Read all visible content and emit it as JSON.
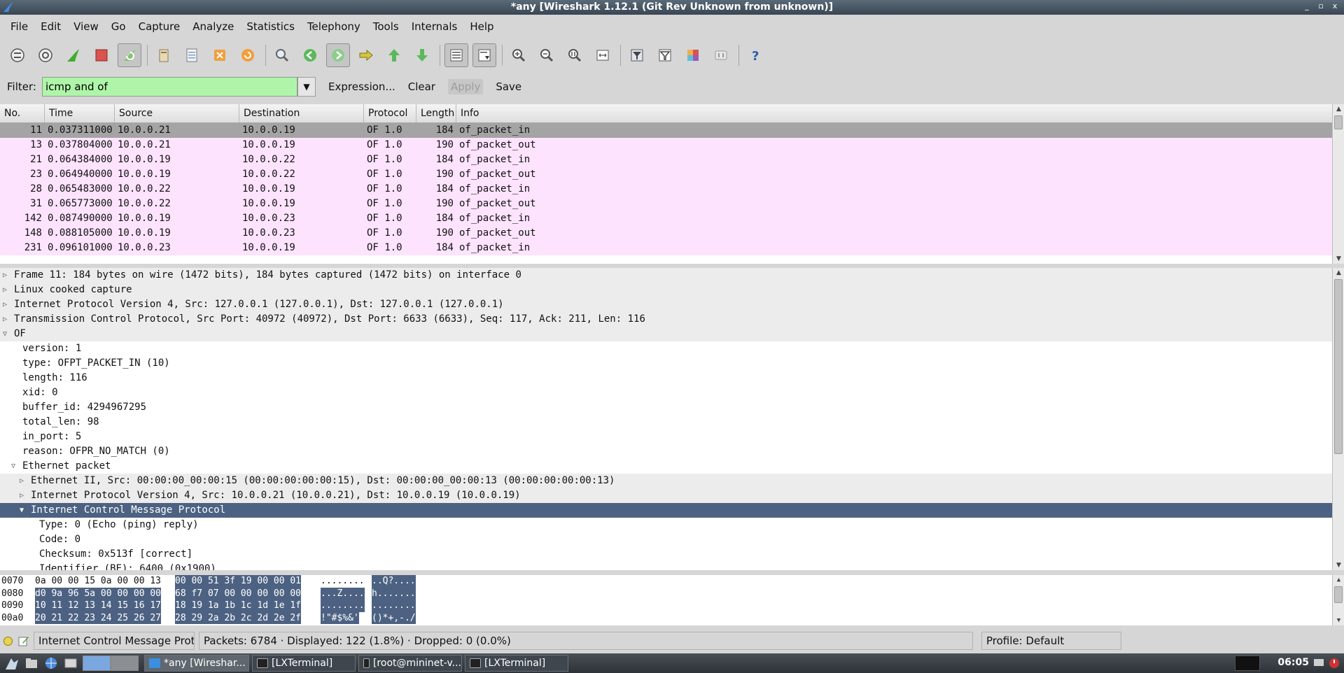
{
  "window": {
    "title": "*any   [Wireshark 1.12.1  (Git Rev Unknown from unknown)]",
    "buttons": [
      "_",
      "▫",
      "x"
    ]
  },
  "menu": [
    "File",
    "Edit",
    "View",
    "Go",
    "Capture",
    "Analyze",
    "Statistics",
    "Telephony",
    "Tools",
    "Internals",
    "Help"
  ],
  "filter": {
    "label": "Filter:",
    "value": "icmp and of",
    "expression_label": "Expression...",
    "clear_label": "Clear",
    "apply_label": "Apply",
    "save_label": "Save"
  },
  "packet_list": {
    "columns": [
      "No.",
      "Time",
      "Source",
      "Destination",
      "Protocol",
      "Length",
      "Info"
    ],
    "rows": [
      {
        "no": "11",
        "time": "0.037311000",
        "src": "10.0.0.21",
        "dst": "10.0.0.19",
        "proto": "OF 1.0",
        "len": "184",
        "info": "of_packet_in"
      },
      {
        "no": "13",
        "time": "0.037804000",
        "src": "10.0.0.21",
        "dst": "10.0.0.19",
        "proto": "OF 1.0",
        "len": "190",
        "info": "of_packet_out"
      },
      {
        "no": "21",
        "time": "0.064384000",
        "src": "10.0.0.19",
        "dst": "10.0.0.22",
        "proto": "OF 1.0",
        "len": "184",
        "info": "of_packet_in"
      },
      {
        "no": "23",
        "time": "0.064940000",
        "src": "10.0.0.19",
        "dst": "10.0.0.22",
        "proto": "OF 1.0",
        "len": "190",
        "info": "of_packet_out"
      },
      {
        "no": "28",
        "time": "0.065483000",
        "src": "10.0.0.22",
        "dst": "10.0.0.19",
        "proto": "OF 1.0",
        "len": "184",
        "info": "of_packet_in"
      },
      {
        "no": "31",
        "time": "0.065773000",
        "src": "10.0.0.22",
        "dst": "10.0.0.19",
        "proto": "OF 1.0",
        "len": "190",
        "info": "of_packet_out"
      },
      {
        "no": "142",
        "time": "0.087490000",
        "src": "10.0.0.19",
        "dst": "10.0.0.23",
        "proto": "OF 1.0",
        "len": "184",
        "info": "of_packet_in"
      },
      {
        "no": "148",
        "time": "0.088105000",
        "src": "10.0.0.19",
        "dst": "10.0.0.23",
        "proto": "OF 1.0",
        "len": "190",
        "info": "of_packet_out"
      },
      {
        "no": "231",
        "time": "0.096101000",
        "src": "10.0.0.23",
        "dst": "10.0.0.19",
        "proto": "OF 1.0",
        "len": "184",
        "info": "of_packet_in"
      }
    ]
  },
  "details": [
    {
      "text": "Frame 11: 184 bytes on wire (1472 bits), 184 bytes captured (1472 bits) on interface 0",
      "level": 0,
      "exp": "closed",
      "style": "shade"
    },
    {
      "text": "Linux cooked capture",
      "level": 0,
      "exp": "closed",
      "style": "shade"
    },
    {
      "text": "Internet Protocol Version 4, Src: 127.0.0.1 (127.0.0.1), Dst: 127.0.0.1 (127.0.0.1)",
      "level": 0,
      "exp": "closed",
      "style": "shade"
    },
    {
      "text": "Transmission Control Protocol, Src Port: 40972 (40972), Dst Port: 6633 (6633), Seq: 117, Ack: 211, Len: 116",
      "level": 0,
      "exp": "closed",
      "style": "shade"
    },
    {
      "text": "OF",
      "level": 0,
      "exp": "open",
      "style": "shade"
    },
    {
      "text": "version: 1",
      "level": 1,
      "exp": "",
      "style": ""
    },
    {
      "text": "type: OFPT_PACKET_IN (10)",
      "level": 1,
      "exp": "",
      "style": ""
    },
    {
      "text": "length: 116",
      "level": 1,
      "exp": "",
      "style": ""
    },
    {
      "text": "xid: 0",
      "level": 1,
      "exp": "",
      "style": ""
    },
    {
      "text": "buffer_id: 4294967295",
      "level": 1,
      "exp": "",
      "style": ""
    },
    {
      "text": "total_len: 98",
      "level": 1,
      "exp": "",
      "style": ""
    },
    {
      "text": "in_port: 5",
      "level": 1,
      "exp": "",
      "style": ""
    },
    {
      "text": "reason: OFPR_NO_MATCH (0)",
      "level": 1,
      "exp": "",
      "style": ""
    },
    {
      "text": "Ethernet packet",
      "level": 1,
      "exp": "open",
      "style": ""
    },
    {
      "text": "Ethernet II, Src: 00:00:00_00:00:15 (00:00:00:00:00:15), Dst: 00:00:00_00:00:13 (00:00:00:00:00:13)",
      "level": 2,
      "exp": "closed",
      "style": "shade"
    },
    {
      "text": "Internet Protocol Version 4, Src: 10.0.0.21 (10.0.0.21), Dst: 10.0.0.19 (10.0.0.19)",
      "level": 2,
      "exp": "closed",
      "style": "shade"
    },
    {
      "text": "Internet Control Message Protocol",
      "level": 2,
      "exp": "open",
      "style": "sel"
    },
    {
      "text": "Type: 0 (Echo (ping) reply)",
      "level": 3,
      "exp": "",
      "style": ""
    },
    {
      "text": "Code: 0",
      "level": 3,
      "exp": "",
      "style": ""
    },
    {
      "text": "Checksum: 0x513f [correct]",
      "level": 3,
      "exp": "",
      "style": ""
    },
    {
      "text": "Identifier (BE): 6400 (0x1900)",
      "level": 3,
      "exp": "",
      "style": ""
    }
  ],
  "bytes": [
    {
      "offset": "0070",
      "hex1": "0a 00 00 15 0a 00 00 13",
      "hex2": "00 00 51 3f 19 00 00 01",
      "ascii1": "........",
      "ascii2": "..Q?...."
    },
    {
      "offset": "0080",
      "hex1": "d0 9a 96 5a 00 00 00 00",
      "hex2": "68 f7 07 00 00 00 00 00",
      "ascii1": "...Z....",
      "ascii2": "h......."
    },
    {
      "offset": "0090",
      "hex1": "10 11 12 13 14 15 16 17",
      "hex2": "18 19 1a 1b 1c 1d 1e 1f",
      "ascii1": "........",
      "ascii2": "........"
    },
    {
      "offset": "00a0",
      "hex1": "20 21 22 23 24 25 26 27",
      "hex2": "28 29 2a 2b 2c 2d 2e 2f",
      "ascii1": " !\"#$%&'",
      "ascii2": "()*+,-./"
    }
  ],
  "status": {
    "field": "Internet Control Message Prot...",
    "packets": "Packets: 6784 · Displayed: 122 (1.8%) · Dropped: 0 (0.0%)",
    "profile": "Profile: Default"
  },
  "taskbar": {
    "tasks": [
      "*any   [Wireshar...",
      "[LXTerminal]",
      "[root@mininet-v...",
      "[LXTerminal]"
    ],
    "clock": "06:05"
  },
  "colors": {
    "packet_row": "#fde3fd",
    "selected_detail": "#4d6282",
    "filter_valid": "#aff5a9"
  }
}
